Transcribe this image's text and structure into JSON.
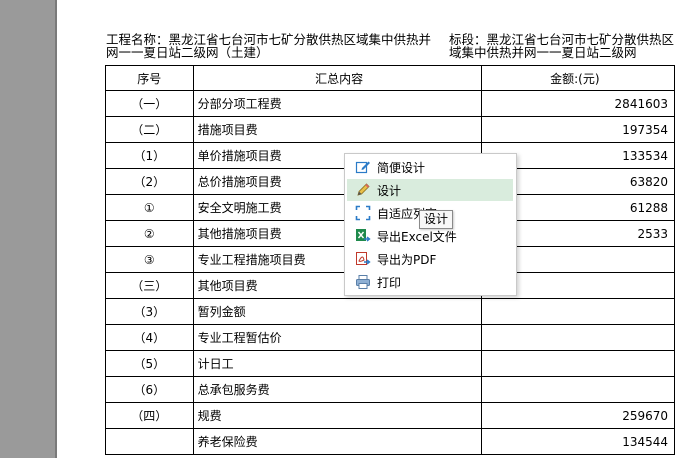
{
  "header": {
    "project_label": "工程名称：黑龙江省七台河市七矿分散供热区域集中供热并网一一夏日站二级网（土建）",
    "section_label": "标段：黑龙江省七台河市七矿分散供热区域集中供热并网一一夏日站二级网"
  },
  "table": {
    "columns": [
      "序号",
      "汇总内容",
      "金额:(元)"
    ],
    "rows": [
      {
        "no": "（一）",
        "name": "分部分项工程费",
        "amount": "2841603"
      },
      {
        "no": "（二）",
        "name": "措施项目费",
        "amount": "197354"
      },
      {
        "no": "（1）",
        "name": "单价措施项目费",
        "amount": "133534"
      },
      {
        "no": "（2）",
        "name": "总价措施项目费",
        "amount": "63820"
      },
      {
        "no": "①",
        "name": "安全文明施工费",
        "amount": "61288"
      },
      {
        "no": "②",
        "name": "其他措施项目费",
        "amount": "2533"
      },
      {
        "no": "③",
        "name": "专业工程措施项目费",
        "amount": ""
      },
      {
        "no": "（三）",
        "name": "其他项目费",
        "amount": ""
      },
      {
        "no": "（3）",
        "name": "暂列金额",
        "amount": ""
      },
      {
        "no": "（4）",
        "name": "专业工程暂估价",
        "amount": ""
      },
      {
        "no": "（5）",
        "name": "计日工",
        "amount": ""
      },
      {
        "no": "（6）",
        "name": "总承包服务费",
        "amount": ""
      },
      {
        "no": "（四）",
        "name": "规费",
        "amount": "259670"
      },
      {
        "no": "",
        "name": "养老保险费",
        "amount": "134544"
      }
    ]
  },
  "context_menu": {
    "items": [
      {
        "label": "简便设计",
        "icon": "edit-icon"
      },
      {
        "label": "设计",
        "icon": "pencil-icon"
      },
      {
        "label": "自适应列宽",
        "icon": "fit-columns-icon"
      },
      {
        "label": "导出Excel文件",
        "icon": "excel-icon"
      },
      {
        "label": "导出为PDF",
        "icon": "pdf-icon"
      },
      {
        "label": "打印",
        "icon": "printer-icon"
      }
    ],
    "highlight_color": "#d9ecdd"
  },
  "tooltip": {
    "text": "设计"
  }
}
